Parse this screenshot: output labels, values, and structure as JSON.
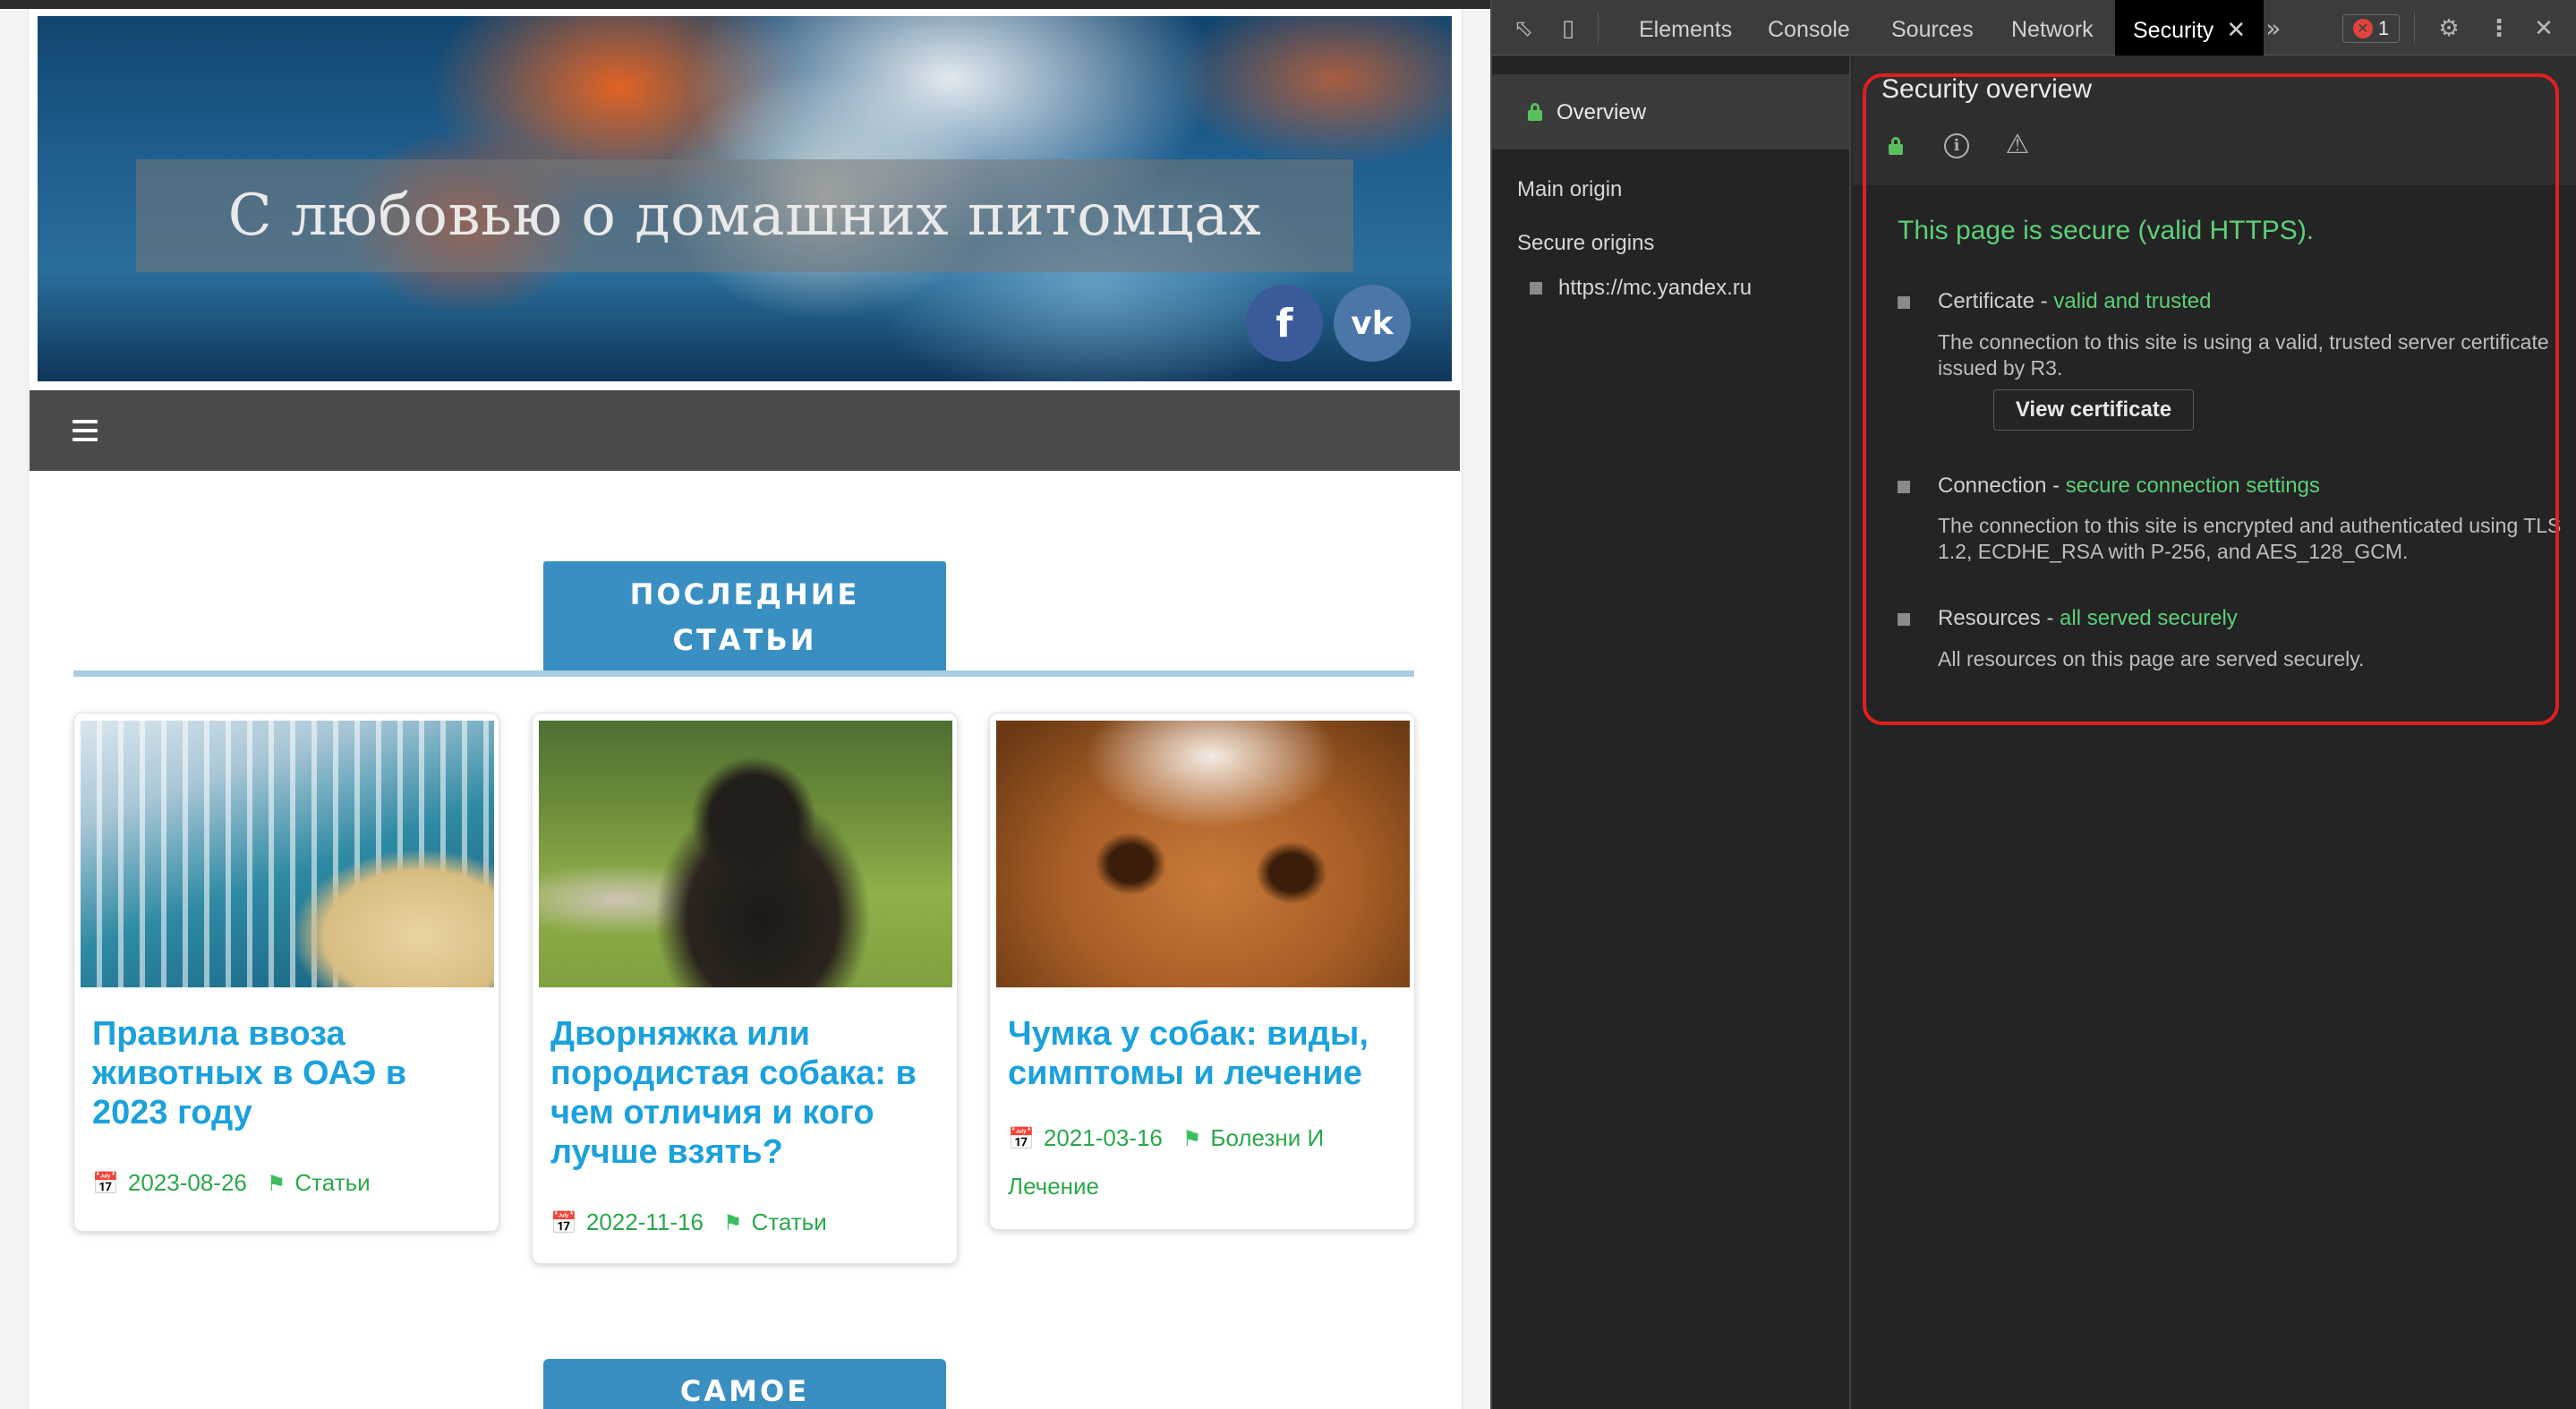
{
  "site": {
    "hero_title": "С любовью о домашних питомцах",
    "social": {
      "facebook": "f",
      "vk": "vk"
    },
    "section_latest": [
      "ПОСЛЕДНИЕ",
      "СТАТЬИ"
    ],
    "section_next": "САМОЕ",
    "cards": [
      {
        "title": "Правила ввоза животных в ОАЭ в 2023 году",
        "date": "2023-08-26",
        "category": "Статьи"
      },
      {
        "title": "Дворняжка или породистая собака: в чем отличия и кого лучше взять?",
        "date": "2022-11-16",
        "category": "Статьи"
      },
      {
        "title": "Чумка у собак: виды, симптомы и лечение",
        "date": "2021-03-16",
        "category": "Болезни И Лечение"
      }
    ]
  },
  "devtools": {
    "tabs": [
      "Elements",
      "Console",
      "Sources",
      "Network",
      "Security"
    ],
    "active_tab": "Security",
    "error_count": "1",
    "sidebar": {
      "overview": "Overview",
      "main_origin": "Main origin",
      "secure_origins": "Secure origins",
      "origin_item": "https://mc.yandex.ru"
    },
    "overview": {
      "title": "Security overview",
      "summary": "This page is secure (valid HTTPS).",
      "certificate": {
        "label": "Certificate - ",
        "status": "valid and trusted",
        "desc": "The connection to this site is using a valid, trusted server certificate issued by R3.",
        "button": "View certificate"
      },
      "connection": {
        "label": "Connection - ",
        "status": "secure connection settings",
        "desc": "The connection to this site is encrypted and authenticated using TLS 1.2, ECDHE_RSA with P-256, and AES_128_GCM."
      },
      "resources": {
        "label": "Resources - ",
        "status": "all served securely",
        "desc": "All resources on this page are served securely."
      }
    },
    "colors": {
      "secure_green": "#5dcf78",
      "highlight_red": "#e02020",
      "active_tab_bg": "#000000"
    }
  }
}
